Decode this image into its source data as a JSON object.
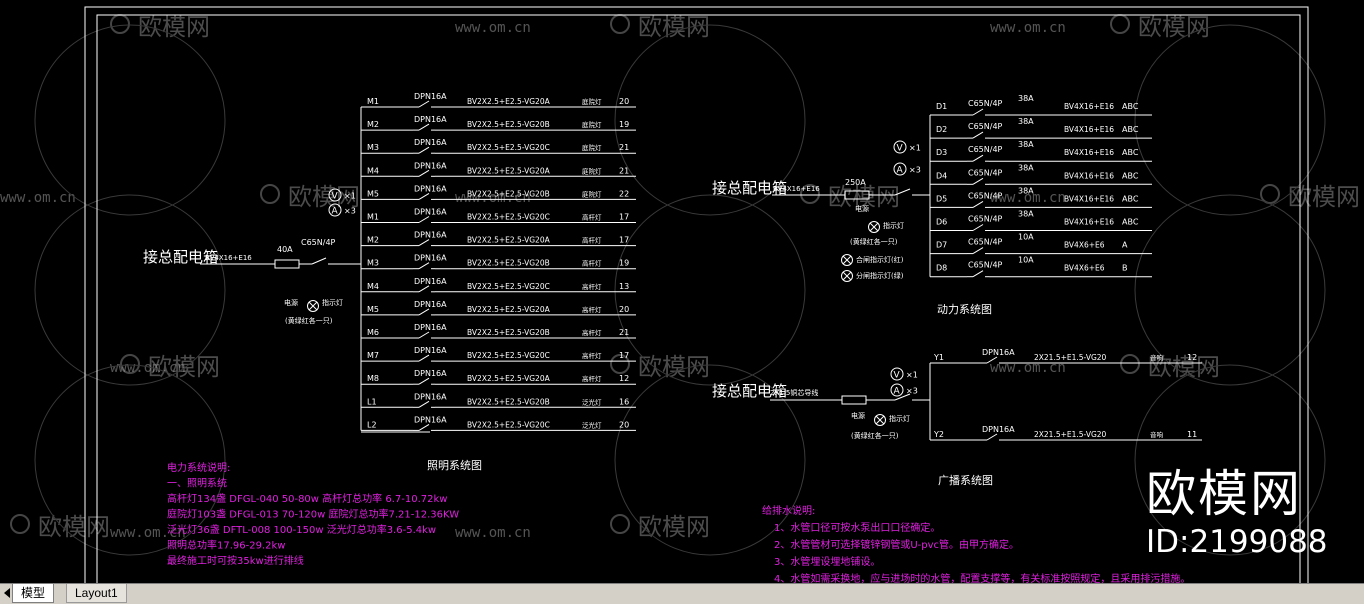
{
  "lighting": {
    "source_label": "接总配电箱",
    "feeder": "BV4X16+E16",
    "fuse": "40A",
    "breaker": "C65N/4P",
    "meter_v": "V",
    "meter_v_count": "×1",
    "meter_a": "A",
    "meter_a_count": "×3",
    "power_label": "电源",
    "lamp_label": "指示灯",
    "lamp_note": "(黄绿红各一只)",
    "title": "照明系统图",
    "circuits": [
      {
        "id": "M1",
        "breaker": "DPN16A",
        "cable": "BV2X2.5+E2.5-VG20A",
        "load": "庭院灯",
        "power": "20"
      },
      {
        "id": "M2",
        "breaker": "DPN16A",
        "cable": "BV2X2.5+E2.5-VG20B",
        "load": "庭院灯",
        "power": "19"
      },
      {
        "id": "M3",
        "breaker": "DPN16A",
        "cable": "BV2X2.5+E2.5-VG20C",
        "load": "庭院灯",
        "power": "21"
      },
      {
        "id": "M4",
        "breaker": "DPN16A",
        "cable": "BV2X2.5+E2.5-VG20A",
        "load": "庭院灯",
        "power": "21"
      },
      {
        "id": "M5",
        "breaker": "DPN16A",
        "cable": "BV2X2.5+E2.5-VG20B",
        "load": "庭院灯",
        "power": "22"
      },
      {
        "id": "M1",
        "breaker": "DPN16A",
        "cable": "BV2X2.5+E2.5-VG20C",
        "load": "高杆灯",
        "power": "17"
      },
      {
        "id": "M2",
        "breaker": "DPN16A",
        "cable": "BV2X2.5+E2.5-VG20A",
        "load": "高杆灯",
        "power": "17"
      },
      {
        "id": "M3",
        "breaker": "DPN16A",
        "cable": "BV2X2.5+E2.5-VG20B",
        "load": "高杆灯",
        "power": "19"
      },
      {
        "id": "M4",
        "breaker": "DPN16A",
        "cable": "BV2X2.5+E2.5-VG20C",
        "load": "高杆灯",
        "power": "13"
      },
      {
        "id": "M5",
        "breaker": "DPN16A",
        "cable": "BV2X2.5+E2.5-VG20A",
        "load": "高杆灯",
        "power": "20"
      },
      {
        "id": "M6",
        "breaker": "DPN16A",
        "cable": "BV2X2.5+E2.5-VG20B",
        "load": "高杆灯",
        "power": "21"
      },
      {
        "id": "M7",
        "breaker": "DPN16A",
        "cable": "BV2X2.5+E2.5-VG20C",
        "load": "高杆灯",
        "power": "17"
      },
      {
        "id": "M8",
        "breaker": "DPN16A",
        "cable": "BV2X2.5+E2.5-VG20A",
        "load": "高杆灯",
        "power": "12"
      },
      {
        "id": "L1",
        "breaker": "DPN16A",
        "cable": "BV2X2.5+E2.5-VG20B",
        "load": "泛光灯",
        "power": "16"
      },
      {
        "id": "L2",
        "breaker": "DPN16A",
        "cable": "BV2X2.5+E2.5-VG20C",
        "load": "泛光灯",
        "power": "20"
      }
    ]
  },
  "power": {
    "source_label": "接总配电箱",
    "feeder": "BV4X16+E16",
    "fuse": "250A",
    "meter_v": "V",
    "meter_v_count": "×1",
    "meter_a": "A",
    "meter_a_count": "×3",
    "power_label": "电源",
    "lamp_label": "指示灯",
    "lamp_note": "(黄绿红各一只)",
    "lamp2": "合闸指示灯(红)",
    "lamp3": "分闸指示灯(绿)",
    "title": "动力系统图",
    "circuits": [
      {
        "id": "D1",
        "breaker": "C65N/4P",
        "amps": "38A",
        "cable": "BV4X16+E16",
        "phase": "ABC"
      },
      {
        "id": "D2",
        "breaker": "C65N/4P",
        "amps": "38A",
        "cable": "BV4X16+E16",
        "phase": "ABC"
      },
      {
        "id": "D3",
        "breaker": "C65N/4P",
        "amps": "38A",
        "cable": "BV4X16+E16",
        "phase": "ABC"
      },
      {
        "id": "D4",
        "breaker": "C65N/4P",
        "amps": "38A",
        "cable": "BV4X16+E16",
        "phase": "ABC"
      },
      {
        "id": "D5",
        "breaker": "C65N/4P",
        "amps": "38A",
        "cable": "BV4X16+E16",
        "phase": "ABC"
      },
      {
        "id": "D6",
        "breaker": "C65N/4P",
        "amps": "38A",
        "cable": "BV4X16+E16",
        "phase": "ABC"
      },
      {
        "id": "D7",
        "breaker": "C65N/4P",
        "amps": "10A",
        "cable": "BV4X6+E6",
        "phase": "A"
      },
      {
        "id": "D8",
        "breaker": "C65N/4P",
        "amps": "10A",
        "cable": "BV4X6+E6",
        "phase": "B"
      }
    ]
  },
  "broadcast": {
    "source_label": "接总配电箱",
    "feeder": "2X1.5铜芯导线",
    "meter_v": "V",
    "meter_v_count": "×1",
    "meter_a": "A",
    "meter_a_count": "×3",
    "power_label": "电源",
    "lamp_label": "指示灯",
    "lamp_note": "(黄绿红各一只)",
    "title": "广播系统图",
    "circuits": [
      {
        "id": "Y1",
        "breaker": "DPN16A",
        "cable": "2X21.5+E1.5-VG20",
        "load": "音响",
        "power": "12"
      },
      {
        "id": "Y2",
        "breaker": "DPN16A",
        "cable": "2X21.5+E1.5-VG20",
        "load": "音响",
        "power": "11"
      }
    ]
  },
  "notes_power": {
    "lines": [
      "电力系统说明:",
      "一、照明系统",
      "高杆灯134盏   DFGL-040     50-80w   高杆灯总功率 6.7-10.72kw",
      "庭院灯103盏   DFGL-013     70-120w      庭院灯总功率7.21-12.36KW",
      "泛光灯36盏    DFTL-008     100-150w   泛光灯总功率3.6-5.4kw",
      "照明总功率17.96-29.2kw",
      "最终施工时可按35kw进行排线"
    ]
  },
  "notes_water": {
    "lines": [
      "给排水说明:",
      "1、水管口径可按水泵出口口径确定。",
      "2、水管管材可选择镀锌钢管或U-pvc管。由甲方确定。",
      "3、水管埋设埋地铺设。",
      "4、水管如需采换地，应与进场时的水管，配置支撑等，有关标准按照规定，且采用排污措施。"
    ]
  },
  "watermark": {
    "brand": "欧模网",
    "url": "www.om.cn",
    "big": "欧模网",
    "id": "ID:2199088"
  },
  "tabs": {
    "model": "模型",
    "layout": "Layout1"
  },
  "colors": {
    "line": "#ffffff",
    "notes": "#e020e0",
    "background": "#000000"
  }
}
